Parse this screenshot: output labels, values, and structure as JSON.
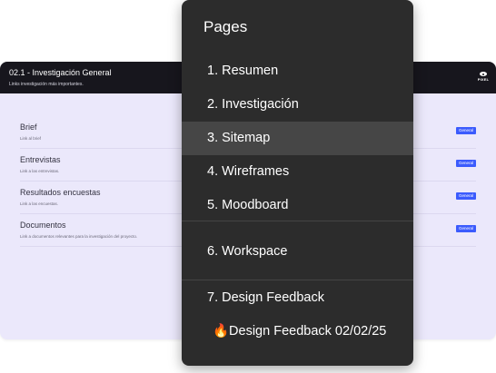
{
  "doc": {
    "title": "02.1 - Investigación General",
    "subtitle": "Links investigación más importantes.",
    "logo_text": "PIXEL",
    "rows": [
      {
        "title": "Brief",
        "desc": "Link al brief",
        "badge": "General"
      },
      {
        "title": "Entrevistas",
        "desc": "Link a las entrevistas.",
        "badge": "General"
      },
      {
        "title": "Resultados encuestas",
        "desc": "Link a las encuestas.",
        "badge": "General"
      },
      {
        "title": "Documentos",
        "desc": "Link a documentos relevantes para la investigación del proyecto.",
        "badge": "General"
      }
    ]
  },
  "pages": {
    "title": "Pages",
    "items": [
      {
        "label": "1. Resumen"
      },
      {
        "label": "2. Investigación"
      },
      {
        "label": "3. Sitemap",
        "selected": true
      },
      {
        "label": "4. Wireframes"
      },
      {
        "label": "5. Moodboard"
      },
      {
        "label": "6. Workspace"
      },
      {
        "label": "7. Design Feedback"
      },
      {
        "label": "🔥Design Feedback 02/02/25"
      }
    ]
  },
  "colors": {
    "panel_bg": "#2c2c2c",
    "panel_selected": "#464646",
    "doc_bg": "#ebe8fb",
    "doc_header": "#17161d",
    "badge": "#3b5bfd"
  }
}
